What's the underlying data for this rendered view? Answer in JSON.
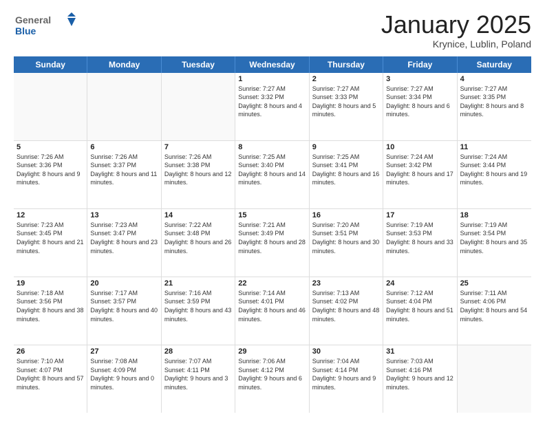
{
  "header": {
    "logo_general": "General",
    "logo_blue": "Blue",
    "month_title": "January 2025",
    "location": "Krynice, Lublin, Poland"
  },
  "days_of_week": [
    "Sunday",
    "Monday",
    "Tuesday",
    "Wednesday",
    "Thursday",
    "Friday",
    "Saturday"
  ],
  "weeks": [
    {
      "cells": [
        {
          "day": "",
          "empty": true
        },
        {
          "day": "",
          "empty": true
        },
        {
          "day": "",
          "empty": true
        },
        {
          "day": "1",
          "sunrise": "7:27 AM",
          "sunset": "3:32 PM",
          "daylight": "8 hours and 4 minutes."
        },
        {
          "day": "2",
          "sunrise": "7:27 AM",
          "sunset": "3:33 PM",
          "daylight": "8 hours and 5 minutes."
        },
        {
          "day": "3",
          "sunrise": "7:27 AM",
          "sunset": "3:34 PM",
          "daylight": "8 hours and 6 minutes."
        },
        {
          "day": "4",
          "sunrise": "7:27 AM",
          "sunset": "3:35 PM",
          "daylight": "8 hours and 8 minutes."
        }
      ]
    },
    {
      "cells": [
        {
          "day": "5",
          "sunrise": "7:26 AM",
          "sunset": "3:36 PM",
          "daylight": "8 hours and 9 minutes."
        },
        {
          "day": "6",
          "sunrise": "7:26 AM",
          "sunset": "3:37 PM",
          "daylight": "8 hours and 11 minutes."
        },
        {
          "day": "7",
          "sunrise": "7:26 AM",
          "sunset": "3:38 PM",
          "daylight": "8 hours and 12 minutes."
        },
        {
          "day": "8",
          "sunrise": "7:25 AM",
          "sunset": "3:40 PM",
          "daylight": "8 hours and 14 minutes."
        },
        {
          "day": "9",
          "sunrise": "7:25 AM",
          "sunset": "3:41 PM",
          "daylight": "8 hours and 16 minutes."
        },
        {
          "day": "10",
          "sunrise": "7:24 AM",
          "sunset": "3:42 PM",
          "daylight": "8 hours and 17 minutes."
        },
        {
          "day": "11",
          "sunrise": "7:24 AM",
          "sunset": "3:44 PM",
          "daylight": "8 hours and 19 minutes."
        }
      ]
    },
    {
      "cells": [
        {
          "day": "12",
          "sunrise": "7:23 AM",
          "sunset": "3:45 PM",
          "daylight": "8 hours and 21 minutes."
        },
        {
          "day": "13",
          "sunrise": "7:23 AM",
          "sunset": "3:47 PM",
          "daylight": "8 hours and 23 minutes."
        },
        {
          "day": "14",
          "sunrise": "7:22 AM",
          "sunset": "3:48 PM",
          "daylight": "8 hours and 26 minutes."
        },
        {
          "day": "15",
          "sunrise": "7:21 AM",
          "sunset": "3:49 PM",
          "daylight": "8 hours and 28 minutes."
        },
        {
          "day": "16",
          "sunrise": "7:20 AM",
          "sunset": "3:51 PM",
          "daylight": "8 hours and 30 minutes."
        },
        {
          "day": "17",
          "sunrise": "7:19 AM",
          "sunset": "3:53 PM",
          "daylight": "8 hours and 33 minutes."
        },
        {
          "day": "18",
          "sunrise": "7:19 AM",
          "sunset": "3:54 PM",
          "daylight": "8 hours and 35 minutes."
        }
      ]
    },
    {
      "cells": [
        {
          "day": "19",
          "sunrise": "7:18 AM",
          "sunset": "3:56 PM",
          "daylight": "8 hours and 38 minutes."
        },
        {
          "day": "20",
          "sunrise": "7:17 AM",
          "sunset": "3:57 PM",
          "daylight": "8 hours and 40 minutes."
        },
        {
          "day": "21",
          "sunrise": "7:16 AM",
          "sunset": "3:59 PM",
          "daylight": "8 hours and 43 minutes."
        },
        {
          "day": "22",
          "sunrise": "7:14 AM",
          "sunset": "4:01 PM",
          "daylight": "8 hours and 46 minutes."
        },
        {
          "day": "23",
          "sunrise": "7:13 AM",
          "sunset": "4:02 PM",
          "daylight": "8 hours and 48 minutes."
        },
        {
          "day": "24",
          "sunrise": "7:12 AM",
          "sunset": "4:04 PM",
          "daylight": "8 hours and 51 minutes."
        },
        {
          "day": "25",
          "sunrise": "7:11 AM",
          "sunset": "4:06 PM",
          "daylight": "8 hours and 54 minutes."
        }
      ]
    },
    {
      "cells": [
        {
          "day": "26",
          "sunrise": "7:10 AM",
          "sunset": "4:07 PM",
          "daylight": "8 hours and 57 minutes."
        },
        {
          "day": "27",
          "sunrise": "7:08 AM",
          "sunset": "4:09 PM",
          "daylight": "9 hours and 0 minutes."
        },
        {
          "day": "28",
          "sunrise": "7:07 AM",
          "sunset": "4:11 PM",
          "daylight": "9 hours and 3 minutes."
        },
        {
          "day": "29",
          "sunrise": "7:06 AM",
          "sunset": "4:12 PM",
          "daylight": "9 hours and 6 minutes."
        },
        {
          "day": "30",
          "sunrise": "7:04 AM",
          "sunset": "4:14 PM",
          "daylight": "9 hours and 9 minutes."
        },
        {
          "day": "31",
          "sunrise": "7:03 AM",
          "sunset": "4:16 PM",
          "daylight": "9 hours and 12 minutes."
        },
        {
          "day": "",
          "empty": true
        }
      ]
    }
  ],
  "labels": {
    "sunrise": "Sunrise:",
    "sunset": "Sunset:",
    "daylight": "Daylight:"
  }
}
